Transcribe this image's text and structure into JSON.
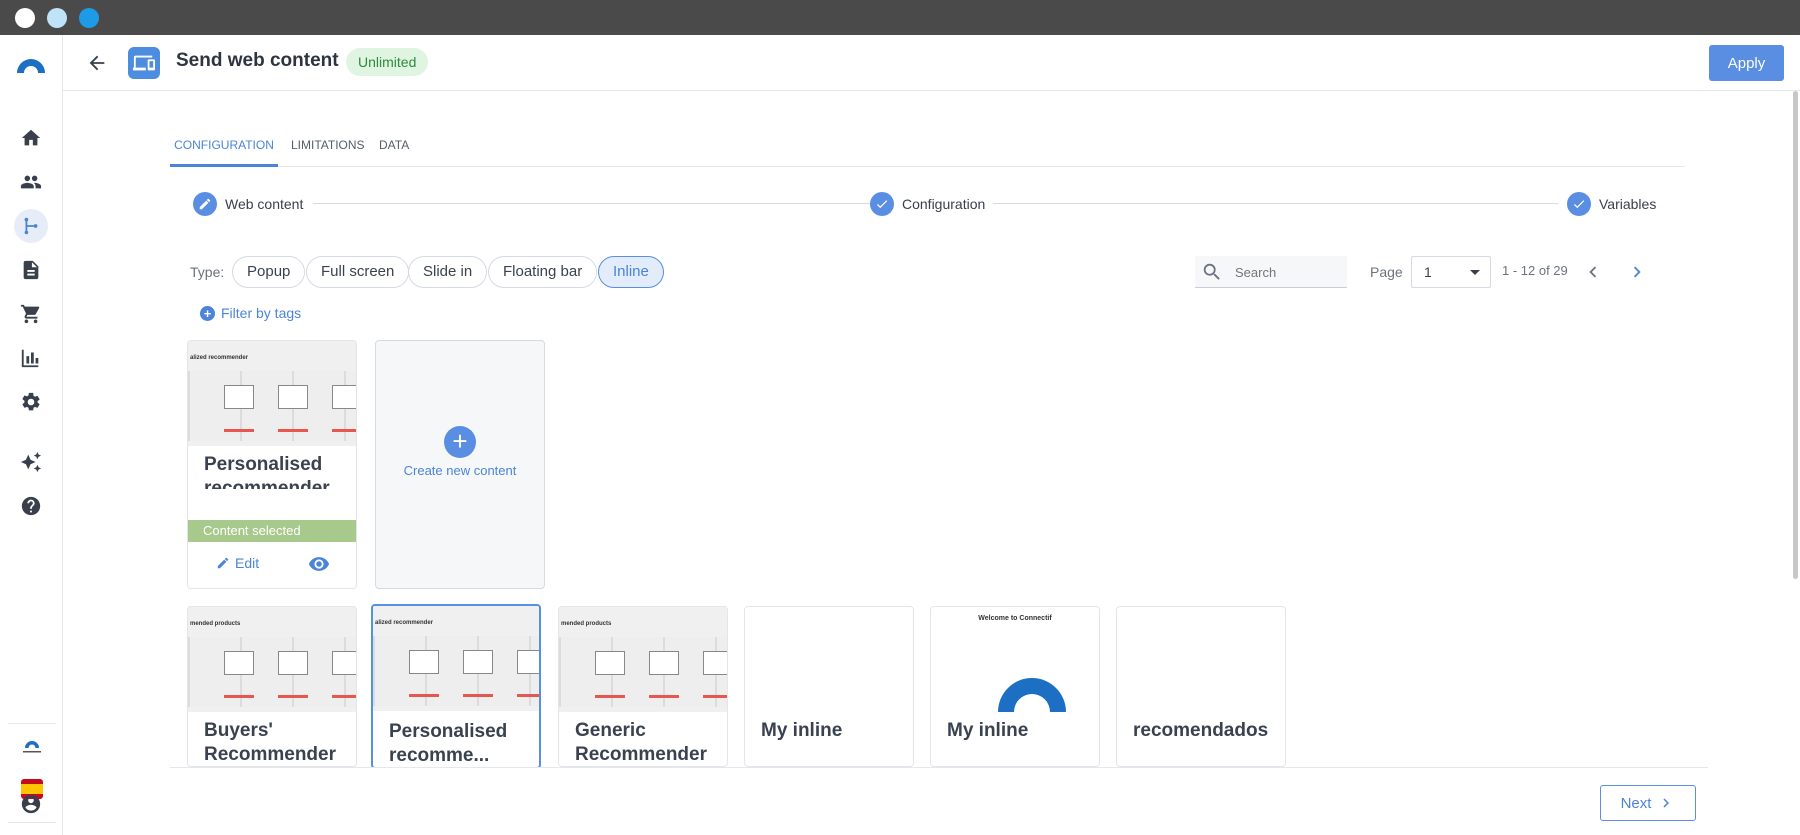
{
  "header": {
    "title": "Send web content",
    "badge": "Unlimited",
    "apply_label": "Apply"
  },
  "tabs": [
    {
      "label": "CONFIGURATION",
      "active": true
    },
    {
      "label": "LIMITATIONS",
      "active": false
    },
    {
      "label": "DATA",
      "active": false
    }
  ],
  "stepper": [
    {
      "label": "Web content",
      "icon": "pencil-icon"
    },
    {
      "label": "Configuration",
      "icon": "check-icon"
    },
    {
      "label": "Variables",
      "icon": "check-icon"
    }
  ],
  "filters": {
    "type_label": "Type:",
    "types": [
      "Popup",
      "Full screen",
      "Slide in",
      "Floating bar",
      "Inline"
    ],
    "active_type": "Inline",
    "filter_tags_label": "Filter by tags"
  },
  "pagination": {
    "search_placeholder": "Search",
    "page_label": "Page",
    "page_value": "1",
    "range": "1 - 12 of 29"
  },
  "selected_card": {
    "thumb_title": "alized recommender",
    "title": "Personalised recommender",
    "selected_label": "Content selected",
    "edit_label": "Edit"
  },
  "create_card": {
    "label": "Create new content"
  },
  "cards": [
    {
      "thumb_title": "mended products",
      "title": "Buyers' Recommender"
    },
    {
      "thumb_title": "alized recommender",
      "title": "Personalised recomme..."
    },
    {
      "thumb_title": "mended products",
      "title": "Generic Recommender"
    },
    {
      "thumb_title": "",
      "title": "My inline"
    },
    {
      "thumb_title": "Welcome to Connectif",
      "title": "My inline"
    },
    {
      "thumb_title": "",
      "title": "recomendados"
    }
  ],
  "footer": {
    "next_label": "Next"
  },
  "colors": {
    "accent": "#5a8ee2",
    "badge_bg": "#dff5e2",
    "selected_bar": "#a7c98c",
    "titlebar": "#4a4a4a"
  }
}
